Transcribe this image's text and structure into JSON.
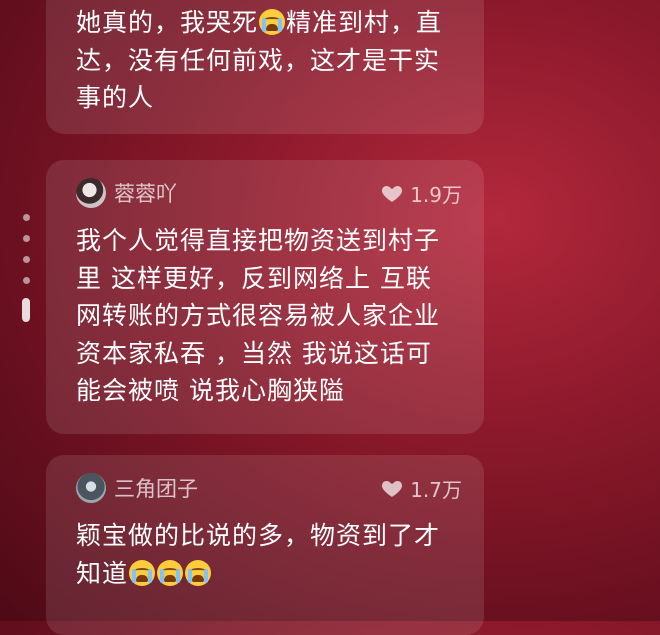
{
  "comments": [
    {
      "text_parts": [
        "她真的，我哭死",
        "精准到村，直达，没有任何前戏，这才是干实事的人"
      ],
      "emoji": "loudly-crying-face"
    },
    {
      "username": "蓉蓉吖",
      "likes": "1.9万",
      "text": "我个人觉得直接把物资送到村子里 这样更好，反到网络上 互联网转账的方式很容易被人家企业资本家私吞 ，当然 我说这话可能会被喷 说我心胸狭隘"
    },
    {
      "username": "三角团子",
      "likes": "1.7万",
      "text": "颖宝做的比说的多，物资到了才知道",
      "emoji": "loudly-crying-face",
      "emoji_count": 3
    }
  ],
  "colors": {
    "background": "#8e1a2c",
    "card": "rgba(255,255,255,0.11)",
    "text": "#ffffff",
    "muted": "rgba(255,255,255,0.72)"
  },
  "icons": [
    "heart-icon",
    "loudly-crying-face-emoji"
  ]
}
